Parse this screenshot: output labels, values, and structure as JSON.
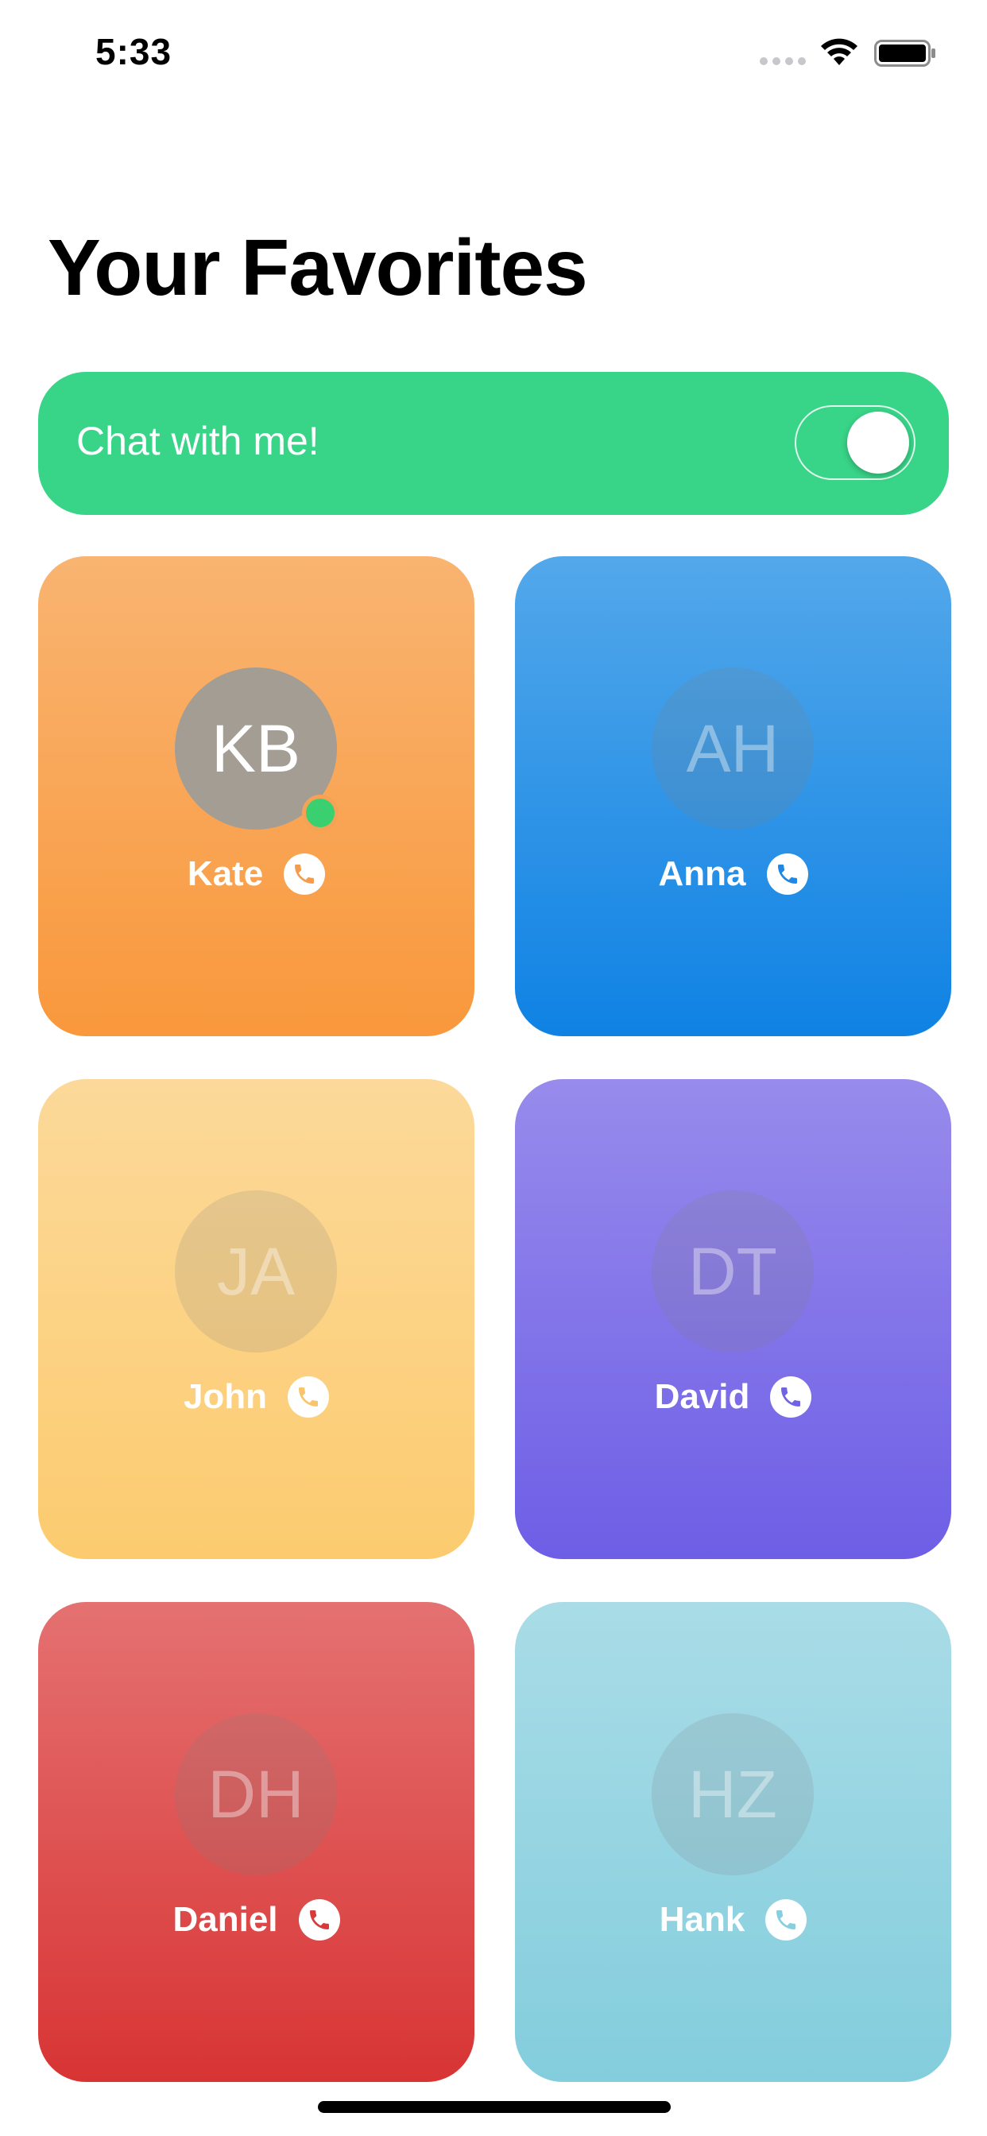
{
  "status_bar": {
    "time": "5:33"
  },
  "header": {
    "title": "Your Favorites"
  },
  "chat_banner": {
    "label": "Chat with me!",
    "toggle_on": true
  },
  "contacts": [
    {
      "initials": "KB",
      "name": "Kate",
      "color": "#f9a04e",
      "online": true,
      "phone_color": "#f59c4c"
    },
    {
      "initials": "AH",
      "name": "Anna",
      "color": "#2a8fe6",
      "online": false,
      "phone_color": "#1f87e4"
    },
    {
      "initials": "JA",
      "name": "John",
      "color": "#fcd17f",
      "online": false,
      "phone_color": "#f7c66c"
    },
    {
      "initials": "DT",
      "name": "David",
      "color": "#7f71e9",
      "online": false,
      "phone_color": "#7163e6"
    },
    {
      "initials": "DH",
      "name": "Daniel",
      "color": "#de4b4b",
      "online": false,
      "phone_color": "#d83a3a"
    },
    {
      "initials": "HZ",
      "name": "Hank",
      "color": "#94d2e0",
      "online": false,
      "phone_color": "#86cee0"
    }
  ]
}
